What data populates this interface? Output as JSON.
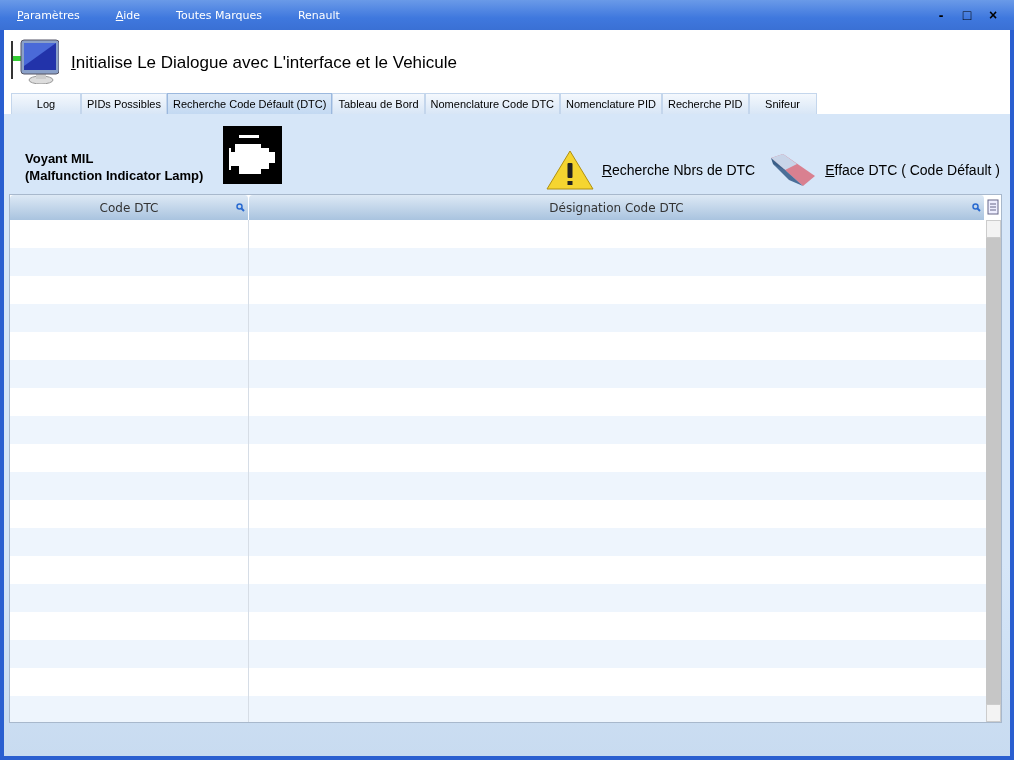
{
  "menu": [
    {
      "label": "Paramètres",
      "underline_first": true
    },
    {
      "label": "Aide",
      "underline_first": true
    },
    {
      "label": "Toutes Marques",
      "underline_first": false
    },
    {
      "label": "Renault",
      "underline_first": false
    }
  ],
  "window_controls": [
    "-",
    "□",
    "×"
  ],
  "header": {
    "title": "Initialise Le Dialogue avec L'interface et le Vehicule"
  },
  "tabs": [
    {
      "label": "Log",
      "selected": false
    },
    {
      "label": "PIDs Possibles",
      "selected": false
    },
    {
      "label": "Recherche Code Défault (DTC)",
      "selected": true
    },
    {
      "label": "Tableau de Bord",
      "selected": false
    },
    {
      "label": "Nomenclature Code DTC",
      "selected": false
    },
    {
      "label": "Nomenclature PID",
      "selected": false
    },
    {
      "label": "Recherche PID",
      "selected": false
    },
    {
      "label": "Snifeur",
      "selected": false
    }
  ],
  "mil": {
    "label_line1": "Voyant MIL",
    "label_line2": "(Malfunction Indicator Lamp)"
  },
  "actions": [
    {
      "kind": "search",
      "label": "Recherche Nbrs de DTC"
    },
    {
      "kind": "erase",
      "label": "Efface DTC ( Code Défault )"
    }
  ],
  "table": {
    "columns": [
      "Code DTC",
      "Désignation Code DTC"
    ]
  }
}
